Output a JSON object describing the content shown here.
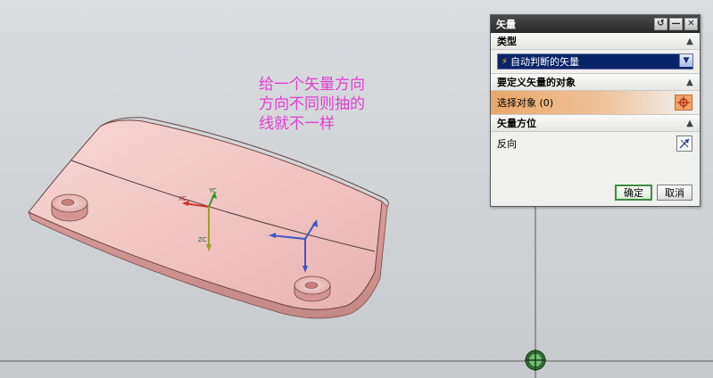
{
  "annotation": {
    "lines": [
      "给一个矢量方向",
      "方向不同则抽的",
      "线就不一样"
    ]
  },
  "axes": {
    "xc": "XC",
    "yc": "YC",
    "zc": "ZC"
  },
  "dialog": {
    "title": "矢量",
    "sections": {
      "type": {
        "header": "类型",
        "selected": "自动判断的矢量"
      },
      "object": {
        "header": "要定义矢量的对象",
        "select_label": "选择对象 (0)"
      },
      "orientation": {
        "header": "矢量方位",
        "reverse_label": "反向"
      }
    },
    "buttons": {
      "ok": "确定",
      "cancel": "取消"
    }
  },
  "colors": {
    "part_fill": "#f2c6c4",
    "annotation": "#e040d0",
    "accent_orange": "#f3a36b",
    "selected_blue": "#0a246a"
  },
  "icons": {
    "title_reset": "reset-icon",
    "title_minimize": "minimize-icon",
    "title_close": "close-icon",
    "select_object": "crosshair-icon",
    "reverse": "reverse-direction-icon",
    "origin_marker": "csys-origin-icon"
  }
}
